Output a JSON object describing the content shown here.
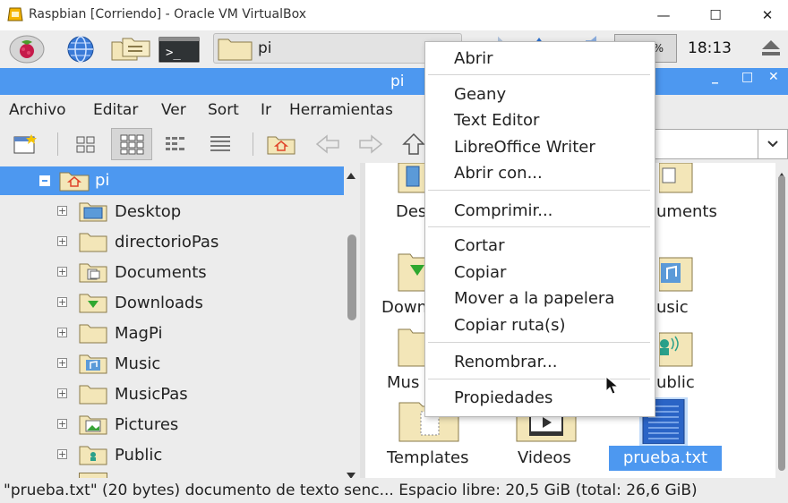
{
  "host_window": {
    "title": "Raspbian [Corriendo] - Oracle VM VirtualBox",
    "minimize_glyph": "—",
    "maximize_glyph": "☐",
    "close_glyph": "✕"
  },
  "taskbar": {
    "window_button_label": "pi",
    "cpu_label": "%",
    "clock": "18:13"
  },
  "fm_window": {
    "title": "pi",
    "ctl_minimize": "_",
    "ctl_maximize": "□",
    "ctl_close": "✕"
  },
  "menubar": {
    "items": [
      "Archivo",
      "Editar",
      "Ver",
      "Sort",
      "Ir",
      "Herramientas"
    ]
  },
  "tree": {
    "root": "pi",
    "items": [
      "Desktop",
      "directorioPas",
      "Documents",
      "Downloads",
      "MagPi",
      "Music",
      "MusicPas",
      "Pictures",
      "Public"
    ]
  },
  "icons": {
    "partial_labels": [
      "Des",
      "uments",
      "Down",
      "usic",
      "Mus",
      "ublic"
    ],
    "templates": "Templates",
    "videos": "Videos",
    "selected_file": "prueba.txt"
  },
  "context_menu": {
    "items": [
      "Abrir",
      "Geany",
      "Text Editor",
      "LibreOffice Writer",
      "Abrir con...",
      "Comprimir...",
      "Cortar",
      "Copiar",
      "Mover a la papelera",
      "Copiar ruta(s)",
      "Renombrar...",
      "Propiedades"
    ]
  },
  "statusbar": {
    "text": "\"prueba.txt\" (20 bytes) documento de texto senc... Espacio libre: 20,5 GiB (total: 26,6 GiB)"
  },
  "colors": {
    "accent": "#4d98f0",
    "folder": "#f3e6b8",
    "panel": "#ececec"
  }
}
